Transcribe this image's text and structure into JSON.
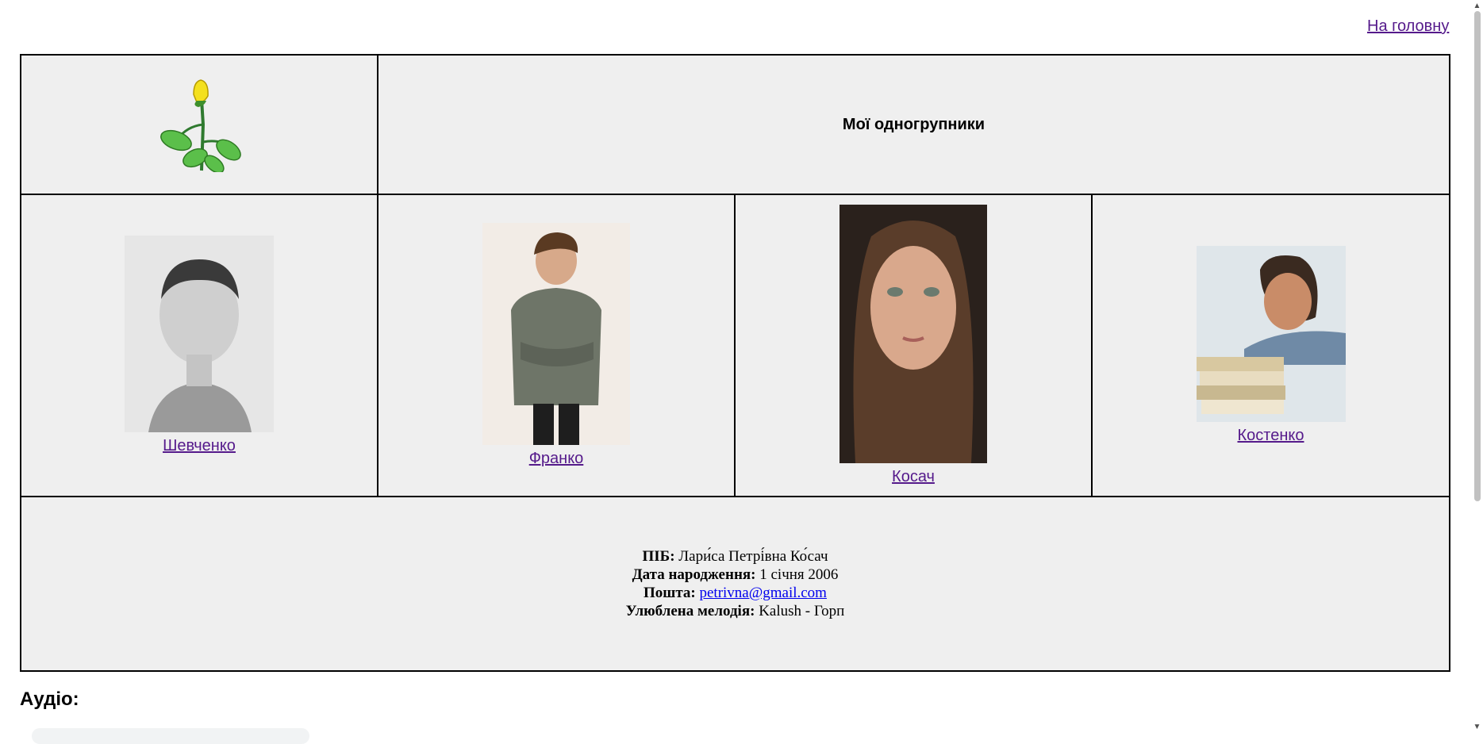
{
  "nav": {
    "home_label": "На головну"
  },
  "header": {
    "title": "Мої одногрупники"
  },
  "classmates": [
    {
      "name": "Шевченко"
    },
    {
      "name": "Франко"
    },
    {
      "name": "Косач"
    },
    {
      "name": "Костенко"
    }
  ],
  "profile": {
    "name_label": "ПІБ:",
    "name_value": "Лари́са Петрі́вна Ко́сач",
    "birth_label": "Дата народження:",
    "birth_value": "1 січня 2006",
    "email_label": "Пошта:",
    "email_value": "petrivna@gmail.com",
    "melody_label": "Улюблена мелодія:",
    "melody_value": "Kalush - Горп"
  },
  "audio": {
    "heading": "Аудіо:"
  },
  "colors": {
    "table_bg": "#efefef",
    "visited_link": "#551a8b",
    "mail_link": "#0000ee"
  },
  "icons": [
    "rose-icon"
  ]
}
